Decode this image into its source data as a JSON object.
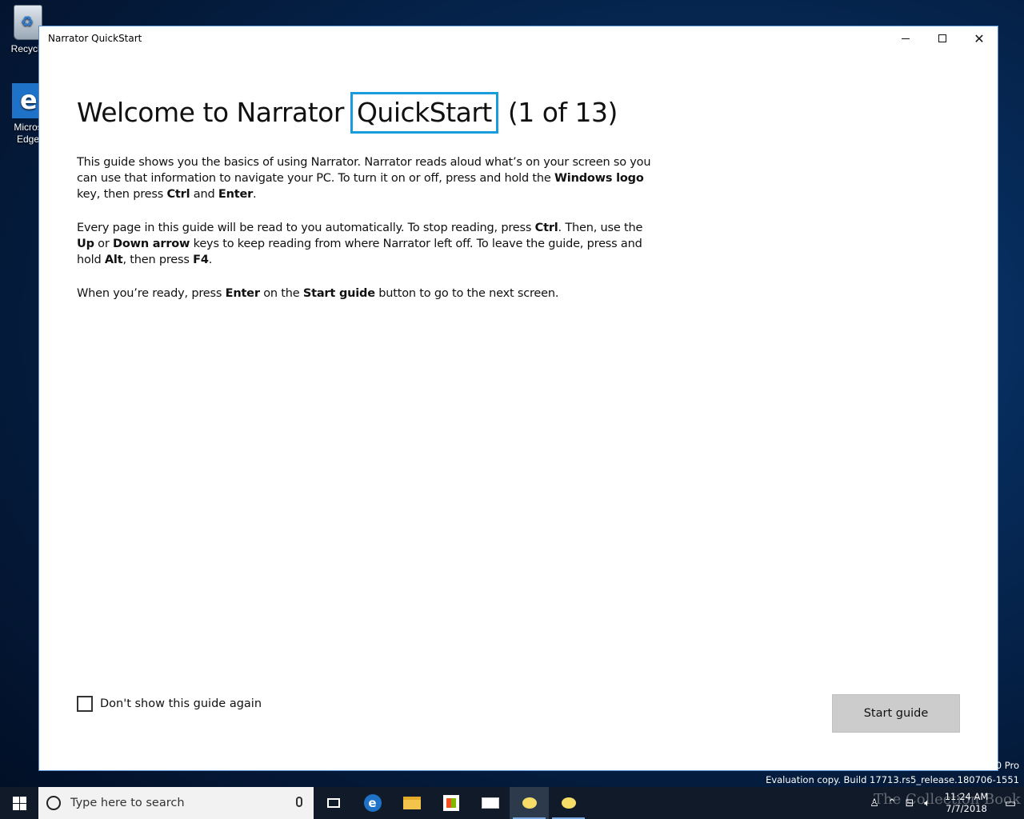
{
  "desktop": {
    "icons": [
      {
        "label": "Recycle"
      },
      {
        "label": "Micros Edge"
      }
    ]
  },
  "window": {
    "title": "Narrator QuickStart",
    "heading_pre": "Welcome to Narrator ",
    "heading_focus": "QuickStart",
    "heading_post": " (1 of 13)",
    "para1": {
      "t1": "This guide shows you the basics of using Narrator. Narrator reads aloud what’s on your screen so you can use that information to navigate your PC. To turn it on or off, press and hold the ",
      "k1": "Windows logo",
      "t2": " key, then press ",
      "k2": "Ctrl",
      "t3": " and ",
      "k3": "Enter",
      "t4": "."
    },
    "para2": {
      "t1": "Every page in this guide will be read to you automatically. To stop reading, press ",
      "k1": "Ctrl",
      "t2": ". Then, use the ",
      "k2": "Up",
      "t3": " or ",
      "k3": "Down arrow",
      "t4": " keys to keep reading from where Narrator left off. To leave the guide, press and hold ",
      "k4": "Alt",
      "t5": ", then press ",
      "k5": "F4",
      "t6": "."
    },
    "para3": {
      "t1": "When you’re ready, press ",
      "k1": "Enter",
      "t2": " on the ",
      "k2": "Start guide",
      "t3": " button to go to the next screen."
    },
    "checkbox_label": "Don't show this guide again",
    "checkbox_checked": false,
    "start_button": "Start guide"
  },
  "watermark": {
    "line1": "0 Pro",
    "line2": "Evaluation copy. Build 17713.rs5_release.180706-1551",
    "overlay": "The Collection Book"
  },
  "taskbar": {
    "search_placeholder": "Type here to search",
    "time": "11:24 AM",
    "date": "7/7/2018"
  }
}
